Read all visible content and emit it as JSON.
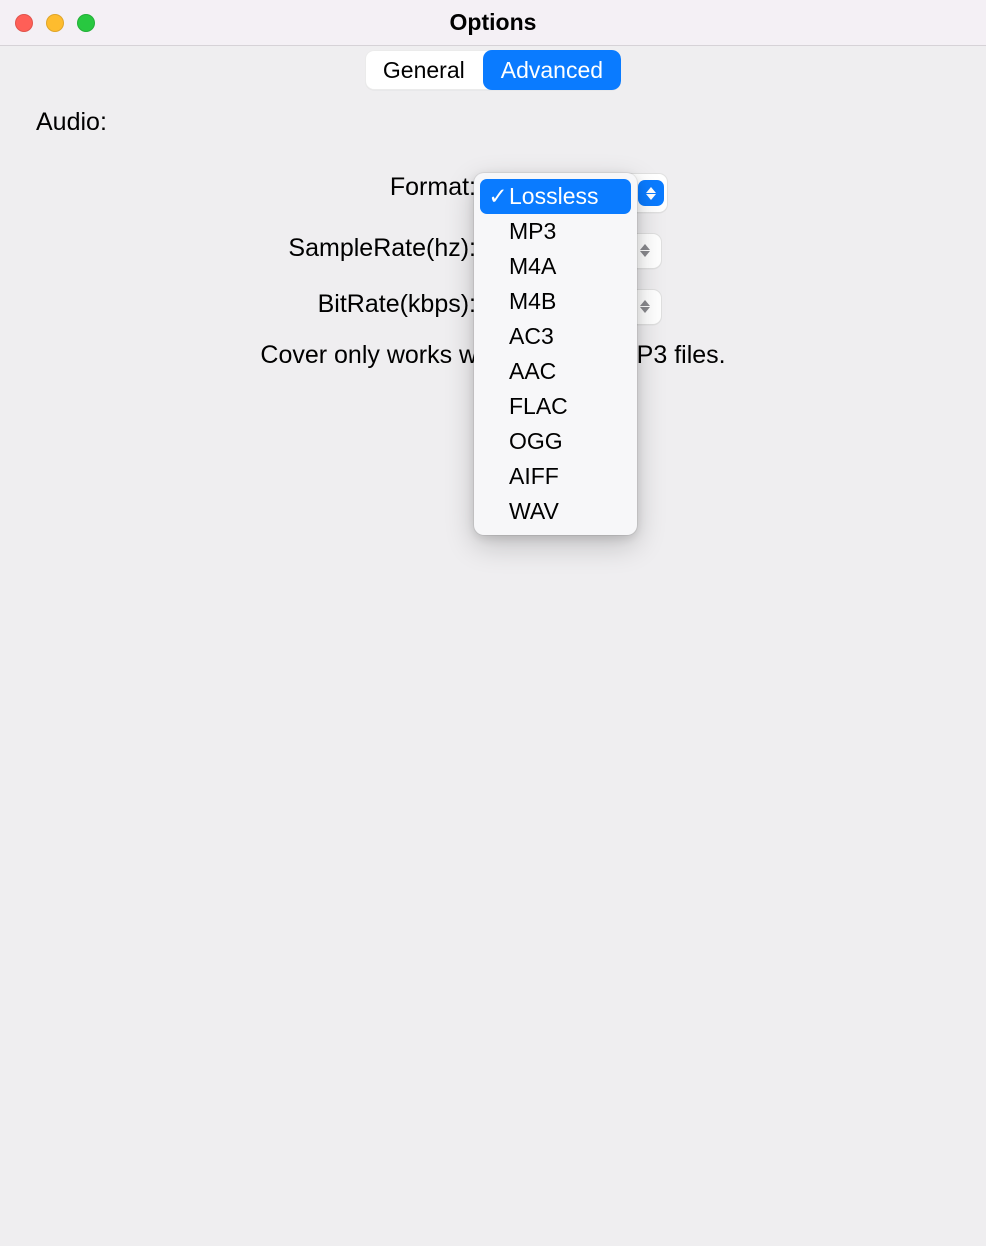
{
  "window": {
    "title": "Options"
  },
  "tabs": {
    "general": "General",
    "advanced": "Advanced"
  },
  "audio": {
    "section_label": "Audio:",
    "format_label": "Format:",
    "samplerate_label": "SampleRate(hz):",
    "bitrate_label": "BitRate(kbps):",
    "note_pre": "Cover only works wi",
    "note_post": "P3 files.",
    "format_menu": {
      "selected_index": 0,
      "options": [
        "Lossless",
        "MP3",
        "M4A",
        "M4B",
        "AC3",
        "AAC",
        "FLAC",
        "OGG",
        "AIFF",
        "WAV"
      ]
    }
  }
}
